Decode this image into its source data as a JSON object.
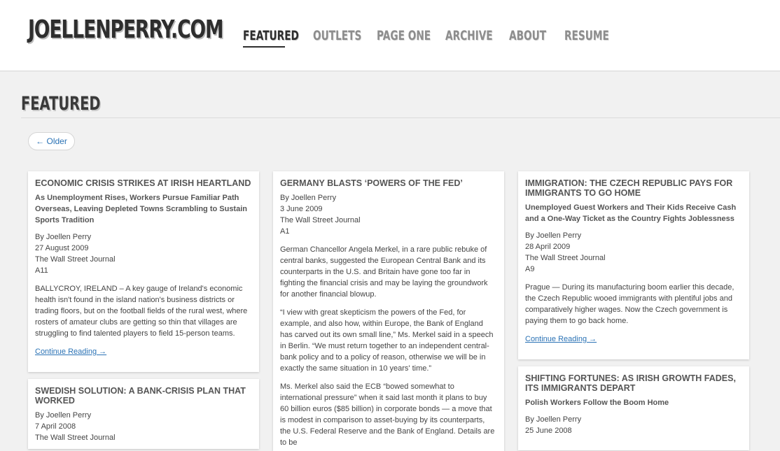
{
  "site": {
    "logo": "JOELLENPERRY.COM"
  },
  "nav": {
    "items": [
      {
        "label": "FEATURED"
      },
      {
        "label": "OUTLETS"
      },
      {
        "label": "PAGE ONE"
      },
      {
        "label": "ARCHIVE"
      },
      {
        "label": "ABOUT"
      },
      {
        "label": "RESUME"
      }
    ],
    "active": "FEATURED"
  },
  "page": {
    "title": "FEATURED",
    "older_label": "← Older"
  },
  "articles": [
    {
      "title": "ECONOMIC CRISIS STRIKES AT IRISH HEARTLAND",
      "subtitle": "As Unemployment Rises, Workers Pursue Familiar Path Overseas, Leaving Depleted Towns Scrambling to Sustain Sports Tradition",
      "byline": "By Joellen Perry",
      "date": "27 August 2009",
      "outlet": "The Wall Street Journal",
      "page": "A11",
      "paragraphs": [
        "BALLYCROY, IRELAND – A key gauge of Ireland's economic health isn't found in the island nation's business districts or trading floors, but on the football fields of the rural west, where rosters of amateur clubs are getting so thin that villages are struggling to find talented players to field 15-person teams."
      ],
      "continue": "Continue Reading →"
    },
    {
      "title": "SWEDISH SOLUTION: A BANK-CRISIS PLAN THAT WORKED",
      "byline": "By Joellen Perry",
      "date": "7 April 2008",
      "outlet": "The Wall Street Journal"
    },
    {
      "title": "GERMANY BLASTS ‘POWERS OF THE FED’",
      "byline": "By Joellen Perry",
      "date": "3 June 2009",
      "outlet": "The Wall Street Journal",
      "page": "A1",
      "paragraphs": [
        "German Chancellor Angela Merkel, in a rare public rebuke of central banks, suggested the European Central Bank and its counterparts in the U.S. and Britain have gone too far in fighting the financial crisis and may be laying the groundwork for another financial blowup.",
        "“I view with great skepticism the powers of the Fed, for example, and also how, within Europe, the Bank of England has carved out its own small line,” Ms. Merkel said in a speech in Berlin. “We must return together to an independent central-bank policy and to a policy of reason, otherwise we will be in exactly the same situation in 10 years' time.”",
        "Ms. Merkel also said the ECB “bowed somewhat to international pressure” when it said last month it plans to buy 60 billion euros ($85 billion) in corporate bonds — a move that is modest in comparison to asset-buying by its counterparts, the U.S. Federal Reserve and the Bank of England. Details are to be"
      ]
    },
    {
      "title": "IMMIGRATION: THE CZECH REPUBLIC PAYS FOR IMMIGRANTS TO GO HOME",
      "subtitle": "Unemployed Guest Workers and Their Kids Receive Cash and a One-Way Ticket as the Country Fights Joblessness",
      "byline": "By Joellen Perry",
      "date": "28 April 2009",
      "outlet": "The Wall Street Journal",
      "page": "A9",
      "paragraphs": [
        "Prague — During its manufacturing boom earlier this decade, the Czech Republic wooed immigrants with plentiful jobs and comparatively higher wages. Now the Czech government is paying them to go back home."
      ],
      "continue": "Continue Reading →"
    },
    {
      "title": "SHIFTING FORTUNES: AS IRISH GROWTH FADES, ITS IMMIGRANTS DEPART",
      "subtitle": "Polish Workers Follow the Boom Home",
      "byline": "By Joellen Perry",
      "date": "25 June 2008"
    }
  ]
}
